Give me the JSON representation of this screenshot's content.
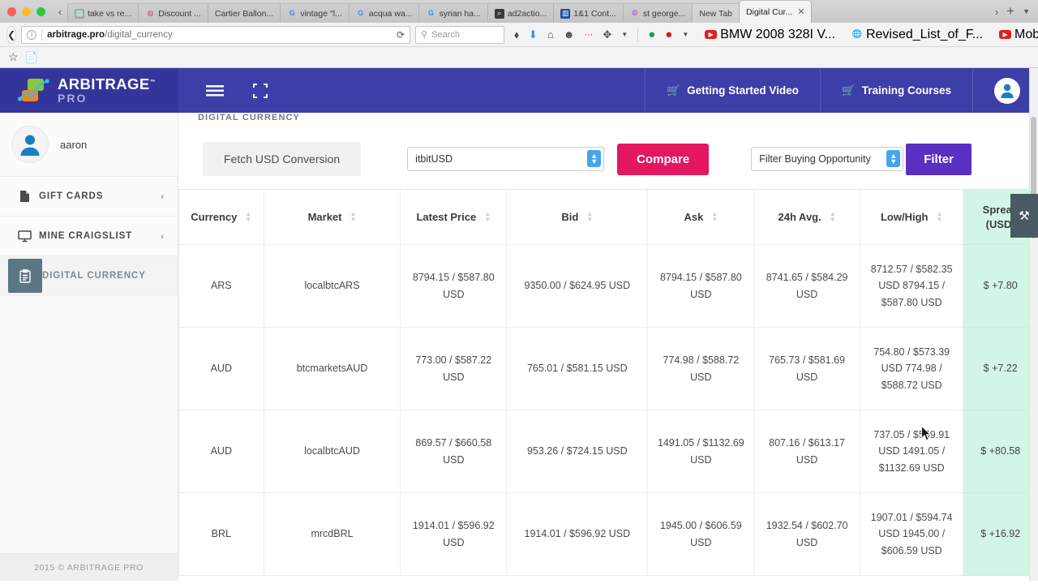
{
  "browser": {
    "tabs": [
      {
        "label": "take vs re...",
        "favicon": "generic-page-icon",
        "active": false
      },
      {
        "label": "Discount ...",
        "favicon": "pink-site-icon",
        "active": false
      },
      {
        "label": "Cartier Ballon...",
        "favicon": "none",
        "active": false
      },
      {
        "label": "vintage \"l...",
        "favicon": "google-icon",
        "active": false
      },
      {
        "label": "acqua wa...",
        "favicon": "google-icon",
        "active": false
      },
      {
        "label": "syrian ha...",
        "favicon": "google-icon",
        "active": false
      },
      {
        "label": "ad2actio...",
        "favicon": "dark-search-icon",
        "active": false
      },
      {
        "label": "1&1 Cont...",
        "favicon": "blue-app-icon",
        "active": false
      },
      {
        "label": "st george...",
        "favicon": "purple-peace-icon",
        "active": false
      },
      {
        "label": "New Tab",
        "favicon": "none",
        "active": false
      },
      {
        "label": "Digital Cur...",
        "favicon": "none",
        "active": true
      }
    ],
    "tab_close_label": "✕",
    "tabstrip_right": [
      "chevron-right-icon",
      "new-tab-plus",
      "tab-list-chevron"
    ],
    "scroll_left_icon": "‹",
    "address": {
      "domain": "arbitrage.pro",
      "path": "/digital_currency",
      "reload_icon": "⟳",
      "info_icon": "i"
    },
    "search": {
      "placeholder": "Search",
      "icon": "search-icon"
    },
    "toolbar_icons": [
      "pocket-icon",
      "download-icon",
      "home-icon",
      "smiley-icon",
      "more-dots-icon",
      "eyedropper-icon",
      "dropdown-chevron"
    ],
    "bookmarks": [
      {
        "label": "",
        "icon": "green-circle-icon"
      },
      {
        "label": "",
        "icon": "red-abp-icon"
      },
      {
        "label": "BMW 2008 328I V...",
        "icon": "youtube-icon"
      },
      {
        "label": "Revised_List_of_F...",
        "icon": "globe-icon"
      },
      {
        "label": "Mobiflight - In Acti...",
        "icon": "youtube-icon"
      }
    ],
    "overflow_icon": "»",
    "menu_icon": "☰"
  },
  "app": {
    "brand": {
      "name": "ARBITRAGE",
      "sub": "PRO",
      "tm": "™"
    },
    "header": {
      "menu_icon": "hamburger-icon",
      "expand_icon": "fullscreen-icon",
      "links": [
        {
          "label": "Getting Started Video",
          "icon": "cart-icon"
        },
        {
          "label": "Training Courses",
          "icon": "cart-icon"
        }
      ],
      "avatar_icon": "user-avatar-icon"
    },
    "sidebar": {
      "user": {
        "name": "aaron",
        "avatar": "user-avatar-icon"
      },
      "items": [
        {
          "label": "GIFT CARDS",
          "icon": "document-icon",
          "chevron": "‹",
          "active": false
        },
        {
          "label": "MINE CRAIGSLIST",
          "icon": "monitor-icon",
          "chevron": "‹",
          "active": false
        },
        {
          "label": "DIGITAL CURRENCY",
          "icon": "clipboard-icon",
          "chevron": "",
          "active": true
        }
      ],
      "footer": "2015 © ARBITRAGE PRO"
    },
    "main": {
      "page_title": "DIGITAL CURRENCY",
      "fetch_button": "Fetch USD Conversion",
      "pair_select": {
        "value": "itbitUSD",
        "options": [
          "itbitUSD"
        ]
      },
      "compare_button": "Compare",
      "opportunity_select": {
        "value": "Filter Buying Opportunity",
        "options": [
          "Filter Buying Opportunity"
        ]
      },
      "filter_button": "Filter",
      "tools_icon": "tools-icon",
      "columns": [
        {
          "label": "Currency",
          "sortable": true
        },
        {
          "label": "Market",
          "sortable": true
        },
        {
          "label": "Latest Price",
          "sortable": true
        },
        {
          "label": "Bid",
          "sortable": true
        },
        {
          "label": "Ask",
          "sortable": true
        },
        {
          "label": "24h Avg.",
          "sortable": true
        },
        {
          "label": "Low/High",
          "sortable": true
        },
        {
          "label": "Spread (USD)",
          "sortable": false
        }
      ],
      "rows": [
        {
          "currency": "ARS",
          "market": "localbtcARS",
          "latest_price": "8794.15 / $587.80 USD",
          "bid": "9350.00 / $624.95 USD",
          "ask": "8794.15 / $587.80 USD",
          "avg24h": "8741.65 / $584.29 USD",
          "low_high": "8712.57 / $582.35 USD 8794.15 / $587.80 USD",
          "spread": "$ +7.80"
        },
        {
          "currency": "AUD",
          "market": "btcmarketsAUD",
          "latest_price": "773.00 / $587.22 USD",
          "bid": "765.01 / $581.15 USD",
          "ask": "774.98 / $588.72 USD",
          "avg24h": "765.73 / $581.69 USD",
          "low_high": "754.80 / $573.39 USD 774.98 / $588.72 USD",
          "spread": "$ +7.22"
        },
        {
          "currency": "AUD",
          "market": "localbtcAUD",
          "latest_price": "869.57 / $660.58 USD",
          "bid": "953.26 / $724.15 USD",
          "ask": "1491.05 / $1132.69 USD",
          "avg24h": "807.16 / $613.17 USD",
          "low_high": "737.05 / $559.91 USD 1491.05 / $1132.69 USD",
          "spread": "$ +80.58"
        },
        {
          "currency": "BRL",
          "market": "mrcdBRL",
          "latest_price": "1914.01 / $596.92 USD",
          "bid": "1914.01 / $596.92 USD",
          "ask": "1945.00 / $606.59 USD",
          "avg24h": "1932.54 / $602.70 USD",
          "low_high": "1907.01 / $594.74 USD 1945.00 / $606.59 USD",
          "spread": "$ +16.92"
        }
      ]
    }
  },
  "colors": {
    "header_blue": "#3d3fa8",
    "brand_blue": "#34359b",
    "compare_pink": "#e3175f",
    "filter_purple": "#5b2fc2",
    "spread_green": "#d3f5e6",
    "sidebar_active": "#5c7684"
  }
}
